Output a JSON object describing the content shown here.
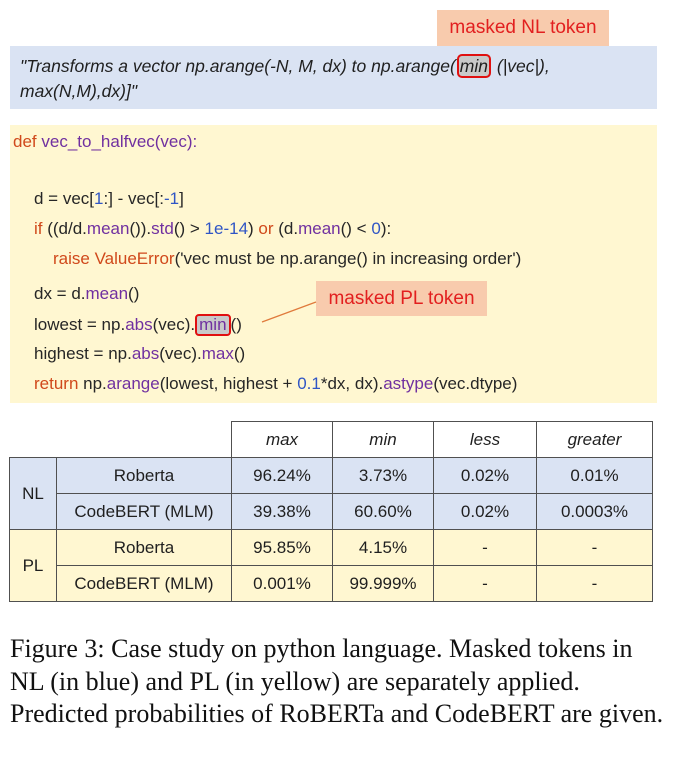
{
  "labels": {
    "nl_token": "masked NL token",
    "pl_token": "masked PL token"
  },
  "nl": {
    "line1_before": "\"Transforms a vector np.arange(-N, M, dx) to np.arange(",
    "masked": "min",
    "line1_after": " (|vec|),",
    "line2": "max(N,M),dx)]\""
  },
  "code": {
    "l1_def": "def",
    "l1_name": " vec_to_halfvec(vec):",
    "l2_text1": "d = vec[",
    "l2_num1": "1",
    "l2_text2": ":] - vec[:",
    "l2_num2": "-1",
    "l2_text3": "]",
    "l3_if": "if",
    "l3_t1": " ((d/d.",
    "l3_mean1": "mean",
    "l3_t2": "()).",
    "l3_std": "std",
    "l3_t3": "() > ",
    "l3_num1": "1e-14",
    "l3_t4": ") ",
    "l3_or": "or",
    "l3_t5": " (d.",
    "l3_mean2": "mean",
    "l3_t6": "() < ",
    "l3_num2": "0",
    "l3_t7": "):",
    "l4_raise": "raise",
    "l4_err": " ValueError",
    "l4_t": "('vec must be np.arange() in increasing order')",
    "l5_t1": "dx = d.",
    "l5_mean": "mean",
    "l5_t2": "()",
    "l6_t1": "lowest = np.",
    "l6_abs": "abs",
    "l6_t2": "(vec).",
    "l6_min": "min",
    "l6_t3": "()",
    "l7_t1": "highest = np.",
    "l7_abs": "abs",
    "l7_t2": "(vec).",
    "l7_max": "max",
    "l7_t3": "()",
    "l8_return": "return",
    "l8_t1": " np.",
    "l8_arange": "arange",
    "l8_t2": "(lowest, highest + ",
    "l8_num": "0.1",
    "l8_t3": "*dx, dx).",
    "l8_astype": "astype",
    "l8_t4": "(vec.dtype)"
  },
  "table": {
    "columns": [
      "max",
      "min",
      "less",
      "greater"
    ],
    "groups": [
      {
        "name": "NL",
        "rows": [
          {
            "model": "Roberta",
            "values": [
              "96.24%",
              "3.73%",
              "0.02%",
              "0.01%"
            ]
          },
          {
            "model": "CodeBERT (MLM)",
            "values": [
              "39.38%",
              "60.60%",
              "0.02%",
              "0.0003%"
            ]
          }
        ]
      },
      {
        "name": "PL",
        "rows": [
          {
            "model": "Roberta",
            "values": [
              "95.85%",
              "4.15%",
              "-",
              "-"
            ]
          },
          {
            "model": "CodeBERT (MLM)",
            "values": [
              "0.001%",
              "99.999%",
              "-",
              "-"
            ]
          }
        ]
      }
    ]
  },
  "caption": "Figure 3: Case study on python language. Masked tokens in NL (in blue) and PL (in yellow) are separately applied. Predicted probabilities of RoBERTa and CodeBERT are given.",
  "colors": {
    "nl_background": "#dae3f3",
    "pl_background": "#fff7d1",
    "label_background": "#f8cbad",
    "label_text": "#e21f1f",
    "keyword": "#d0491b",
    "method": "#7030a0",
    "number": "#2f55c5"
  }
}
